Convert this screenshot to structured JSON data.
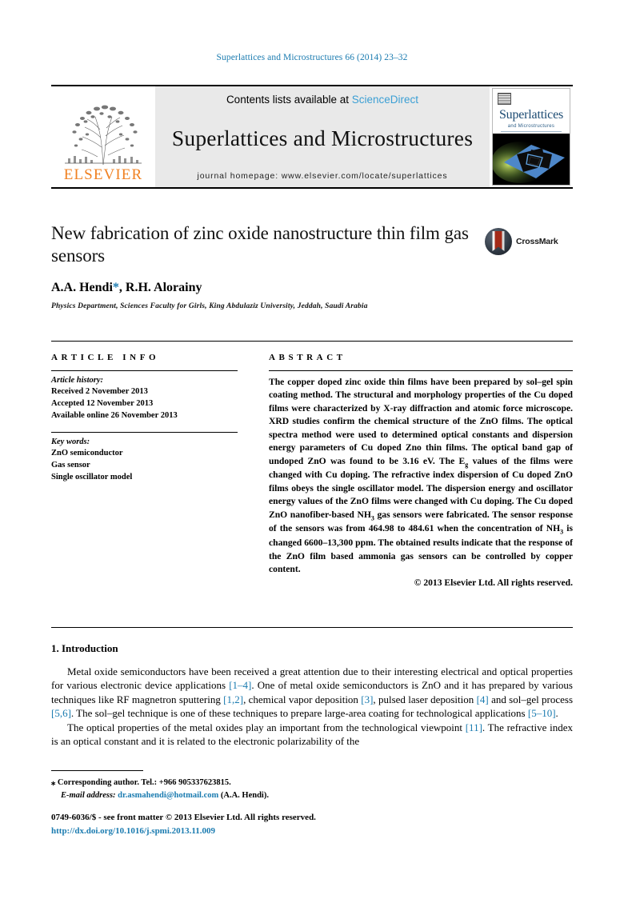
{
  "running_head": "Superlattices and Microstructures 66 (2014) 23–32",
  "masthead": {
    "publisher_logo_word": "ELSEVIER",
    "contents_prefix": "Contents lists available at ",
    "contents_link": "ScienceDirect",
    "journal_name": "Superlattices and Microstructures",
    "homepage_line": "journal homepage: www.elsevier.com/locate/superlattices",
    "cover": {
      "title": "Superlattices",
      "subtitle": "and Microstructures"
    }
  },
  "article": {
    "title": "New fabrication of zinc oxide nanostructure thin film gas sensors",
    "crossmark_label": "CrossMark",
    "authors_prefix": "A.A. Hendi",
    "authors_star": "*",
    "authors_suffix": ", R.H. Alorainy",
    "affiliation": "Physics Department, Sciences Faculty for Girls, King Abdulaziz University, Jeddah, Saudi Arabia"
  },
  "article_info": {
    "heading": "ARTICLE INFO",
    "history_label": "Article history:",
    "history": [
      "Received 2 November 2013",
      "Accepted 12 November 2013",
      "Available online 26 November 2013"
    ],
    "keywords_label": "Key words:",
    "keywords": [
      "ZnO semiconductor",
      "Gas sensor",
      "Single oscillator model"
    ]
  },
  "abstract": {
    "heading": "ABSTRACT",
    "text_part_1": "The copper doped zinc oxide thin films have been prepared by sol–gel spin coating method. The structural and morphology properties of the Cu doped films were characterized by X-ray diffraction and atomic force microscope. XRD studies confirm the chemical structure of the ZnO films. The optical spectra method were used to determined optical constants and dispersion energy parameters of Cu doped Zno thin films. The optical band gap of undoped ZnO was found to be 3.16 eV. The E",
    "sub_g": "g",
    "text_part_2": " values of the films were changed with Cu doping. The refractive index dispersion of Cu doped ZnO films obeys the single oscillator model. The dispersion energy and oscillator energy values of the ZnO films were changed with Cu doping. The Cu doped ZnO nanofiber-based NH",
    "sub_3a": "3",
    "text_part_3": " gas sensors were fabricated. The sensor response of the sensors was from 464.98 to 484.61 when the concentration of NH",
    "sub_3b": "3",
    "text_part_4": " is changed 6600–13,300 ppm. The obtained results indicate that the response of the ZnO film based ammonia gas sensors can be controlled by copper content.",
    "copyright": "© 2013 Elsevier Ltd. All rights reserved."
  },
  "body": {
    "section_heading": "1. Introduction",
    "para_1_a": "Metal oxide semiconductors have been received a great attention due to their interesting electrical and optical properties for various electronic device applications ",
    "ref_1_4": "[1–4]",
    "para_1_b": ". One of metal oxide semiconductors is ZnO and it has prepared by various techniques like RF magnetron sputtering ",
    "ref_1_2": "[1,2]",
    "para_1_c": ", chemical vapor deposition ",
    "ref_3": "[3]",
    "para_1_d": ", pulsed laser deposition ",
    "ref_4": "[4]",
    "para_1_e": " and sol–gel process ",
    "ref_5_6": "[5,6]",
    "para_1_f": ". The sol–gel technique is one of these techniques to prepare large-area coating for technological applications ",
    "ref_5_10": "[5–10]",
    "para_1_g": ".",
    "para_2_a": "The optical properties of the metal oxides play an important from the technological viewpoint ",
    "ref_11": "[11]",
    "para_2_b": ". The refractive index is an optical constant and it is related to the electronic polarizability of the"
  },
  "footnote": {
    "star": "⁎",
    "corresponding": " Corresponding author. Tel.: +966 905337623815.",
    "email_label": "E-mail address:",
    "email": "dr.asmahendi@hotmail.com",
    "email_owner": " (A.A. Hendi)."
  },
  "footer": {
    "issn_line": "0749-6036/$ - see front matter © 2013 Elsevier Ltd. All rights reserved.",
    "doi": "http://dx.doi.org/10.1016/j.spmi.2013.11.009"
  },
  "colors": {
    "link": "#1a7bb0",
    "science_direct": "#3b9fd4",
    "elsevier_orange": "#F08122",
    "masthead_bg": "#e9e9e9"
  }
}
